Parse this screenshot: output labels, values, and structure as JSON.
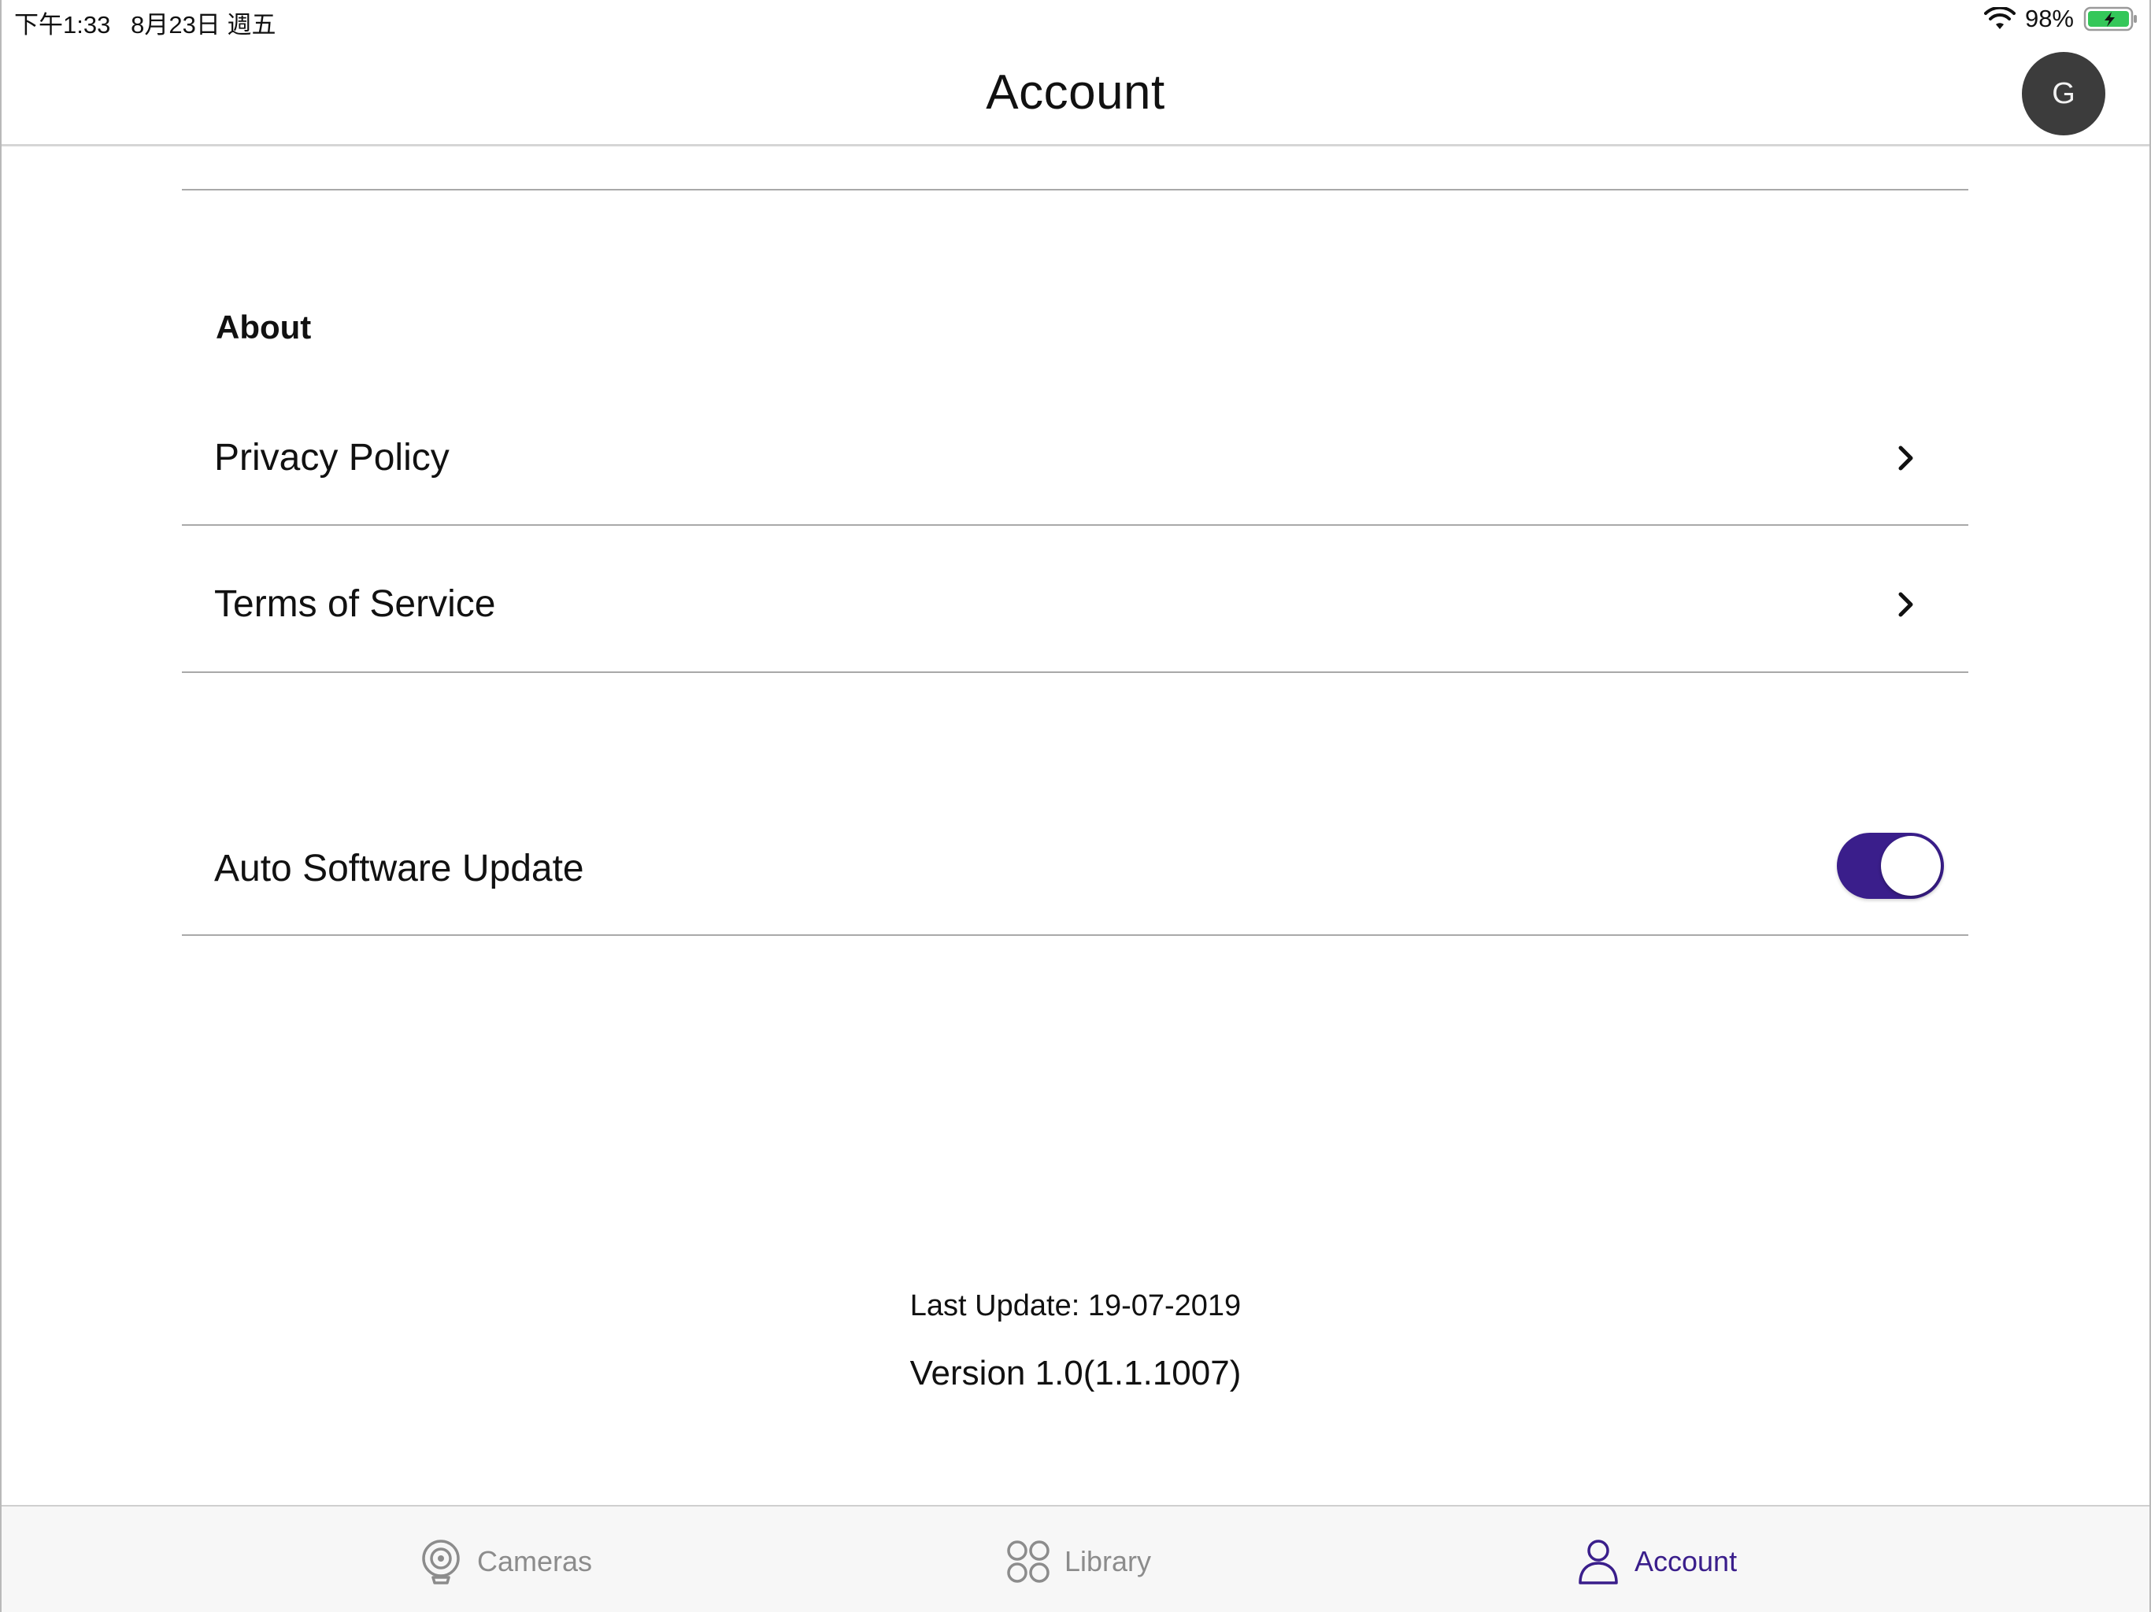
{
  "status_bar": {
    "time_date": "下午1:33   8月23日 週五",
    "battery": "98%",
    "icons": [
      "wifi-icon",
      "battery-charging-icon"
    ]
  },
  "header": {
    "title": "Account",
    "avatar_initial": "G"
  },
  "about": {
    "heading": "About",
    "items": [
      {
        "label": "Privacy Policy",
        "icon": "chevron-right-icon"
      },
      {
        "label": "Terms of Service",
        "icon": "chevron-right-icon"
      }
    ]
  },
  "settings": {
    "auto_update_label": "Auto Software Update",
    "auto_update_enabled": true
  },
  "footer_info": {
    "last_update": "Last Update: 19-07-2019",
    "version": "Version 1.0(1.1.1007)"
  },
  "tab_bar": {
    "tabs": [
      {
        "label": "Cameras",
        "icon": "camera-icon",
        "active": false
      },
      {
        "label": "Library",
        "icon": "grid-icon",
        "active": false
      },
      {
        "label": "Account",
        "icon": "person-icon",
        "active": true
      }
    ]
  },
  "colors": {
    "accent": "#3a1e8b",
    "inactive_tab": "#8c8c8c",
    "avatar_bg": "#3c3c3c"
  }
}
